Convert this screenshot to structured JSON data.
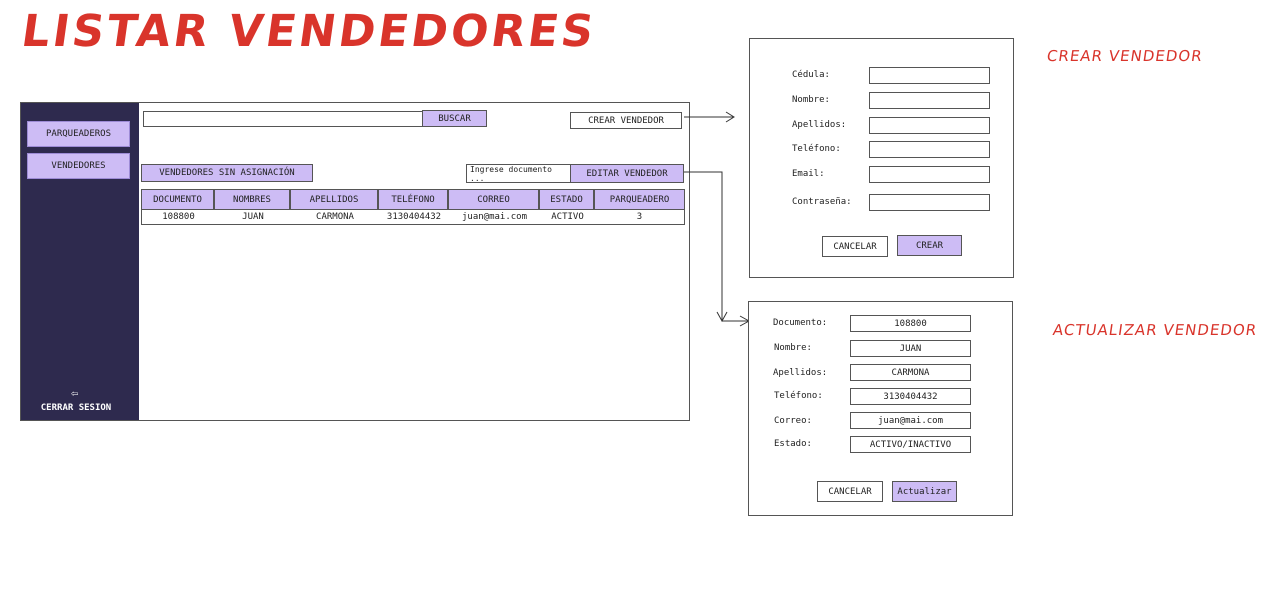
{
  "page_title": "LISTAR VENDEDORES",
  "sidebar": {
    "items": [
      {
        "label": "PARQUEADEROS"
      },
      {
        "label": "VENDEDORES"
      }
    ],
    "logout_label": "CERRAR SESION",
    "logout_icon": "logout-icon"
  },
  "toolbar": {
    "search_value": "",
    "search_button": "BUSCAR",
    "create_button": "CREAR VENDEDOR",
    "unassigned_button": "VENDEDORES SIN ASIGNACIÓN",
    "document_placeholder": "Ingrese documento ...",
    "edit_button": "EDITAR VENDEDOR"
  },
  "table": {
    "columns": [
      "DOCUMENTO",
      "NOMBRES",
      "APELLIDOS",
      "TELÉFONO",
      "CORREO",
      "ESTADO",
      "PARQUEADERO"
    ],
    "rows": [
      [
        "108800",
        "JUAN",
        "CARMONA",
        "3130404432",
        "juan@mai.com",
        "ACTIVO",
        "3"
      ]
    ]
  },
  "create_form": {
    "title": "CREAR VENDEDOR",
    "fields": [
      {
        "label": "Cédula:",
        "value": ""
      },
      {
        "label": "Nombre:",
        "value": ""
      },
      {
        "label": "Apellidos:",
        "value": ""
      },
      {
        "label": "Teléfono:",
        "value": ""
      },
      {
        "label": "Email:",
        "value": ""
      },
      {
        "label": "Contraseña:",
        "value": ""
      }
    ],
    "cancel": "CANCELAR",
    "submit": "CREAR"
  },
  "update_form": {
    "title": "ACTUALIZAR VENDEDOR",
    "fields": [
      {
        "label": "Documento:",
        "value": "108800"
      },
      {
        "label": "Nombre:",
        "value": "JUAN"
      },
      {
        "label": "Apellidos:",
        "value": "CARMONA"
      },
      {
        "label": "Teléfono:",
        "value": "3130404432"
      },
      {
        "label": "Correo:",
        "value": "juan@mai.com"
      },
      {
        "label": "Estado:",
        "value": "ACTIVO/INACTIVO"
      }
    ],
    "cancel": "CANCELAR",
    "submit": "Actualizar"
  },
  "colors": {
    "accent": "#cdbcf5",
    "sidebar": "#2e2a4e",
    "annotation": "#d9342b"
  }
}
